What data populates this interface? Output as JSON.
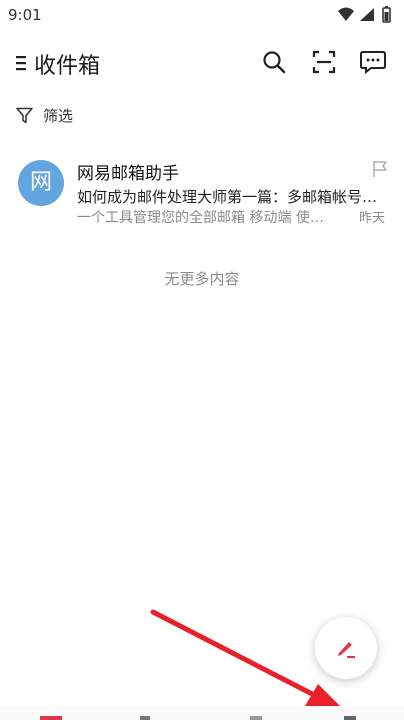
{
  "status_bar": {
    "time": "9:01"
  },
  "app_bar": {
    "title": "收件箱"
  },
  "filter": {
    "label": "筛选"
  },
  "mail_list": {
    "items": [
      {
        "avatar_letter": "网",
        "sender": "网易邮箱助手",
        "subject": "如何成为邮件处理大师第一篇：多邮箱帐号…",
        "preview": "一个工具管理您的全部邮箱 移动端 使…",
        "date": "昨天"
      }
    ]
  },
  "list_end": {
    "text": "无更多内容"
  },
  "icons": {
    "menu": "menu-icon",
    "search": "search-icon",
    "scan": "scan-icon",
    "chat": "chat-icon",
    "filter": "filter-icon",
    "flag": "flag-icon",
    "compose": "pencil-icon"
  },
  "colors": {
    "avatar_bg": "#63a6df",
    "compose_accent": "#e0384b",
    "arrow": "#e8202c"
  }
}
